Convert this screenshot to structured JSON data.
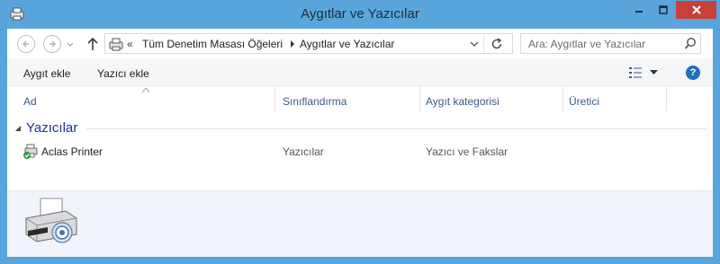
{
  "window": {
    "title": "Aygıtlar ve Yazıcılar",
    "title_icon": "devices-printers-icon",
    "close_button_color": "#c7403a",
    "frame_color": "#59a5db"
  },
  "address_bar": {
    "overflow_label": "«",
    "breadcrumbs": [
      "Tüm Denetim Masası Öğeleri",
      "Aygıtlar ve Yazıcılar"
    ]
  },
  "search": {
    "placeholder": "Ara: Aygıtlar ve Yazıcılar"
  },
  "toolbar": {
    "add_device_label": "Aygıt ekle",
    "add_printer_label": "Yazıcı ekle",
    "help_label": "?"
  },
  "columns": [
    "Ad",
    "Sınıflandırma",
    "Aygıt kategorisi",
    "Üretici"
  ],
  "groups": [
    {
      "title": "Yazıcılar",
      "items": [
        {
          "name": "Aclas Printer",
          "classification": "Yazıcılar",
          "category": "Yazıcı ve Fakslar",
          "manufacturer": "",
          "icon": "default-printer-icon"
        }
      ]
    }
  ],
  "details_pane": {
    "icon": "printer-large-icon"
  }
}
